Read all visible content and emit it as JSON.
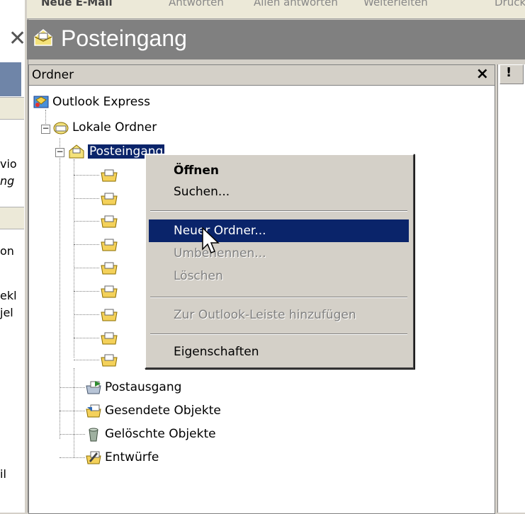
{
  "window": {
    "title": "Posteingang",
    "toolbar_items": [
      "Neue E-Mail",
      "Antworten",
      "Allen antworten",
      "Weiterleiten",
      "Drucken"
    ]
  },
  "left_fragments": [
    "vio",
    "ng",
    "on",
    "ekl",
    "jel",
    "il"
  ],
  "folder_pane": {
    "header": "Ordner",
    "close_glyph": "×",
    "tree": {
      "root": "Outlook Express",
      "local": "Lokale Ordner",
      "inbox": "Posteingang",
      "outbox": "Postausgang",
      "sent": "Gesendete Objekte",
      "deleted": "Gelöschte Objekte",
      "drafts": "Entwürfe"
    }
  },
  "message_list": {
    "priority_header": "!"
  },
  "context_menu": {
    "open": "Öffnen",
    "search": "Suchen...",
    "new_folder": "Neuer Ordner...",
    "rename": "Umbenennen...",
    "delete": "Löschen",
    "add_to_bar": "Zur Outlook-Leiste hinzufügen",
    "properties": "Eigenschaften"
  },
  "colors": {
    "selection": "#0a246a",
    "titlebar": "#808080",
    "face": "#d4d0c8"
  }
}
